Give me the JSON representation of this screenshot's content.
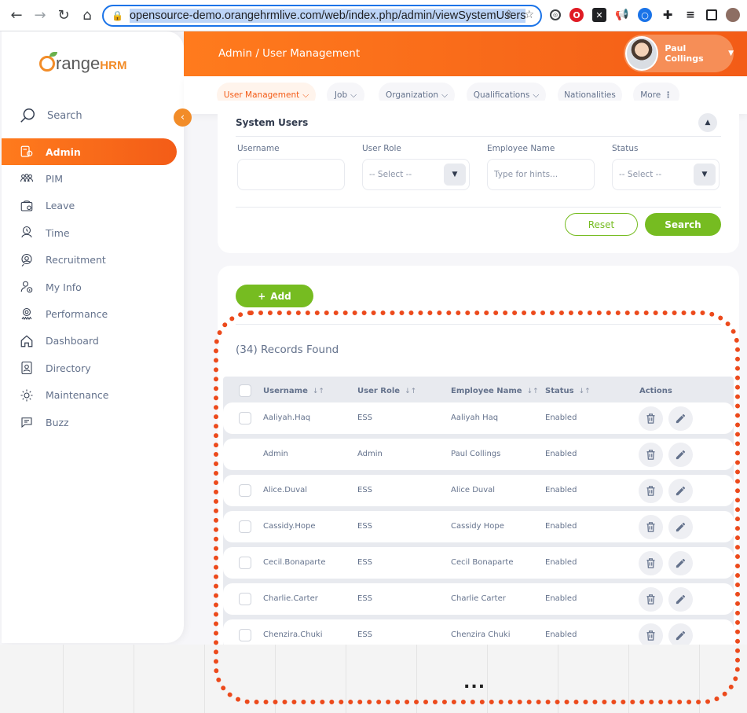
{
  "browser": {
    "url": "opensource-demo.orangehrmlive.com/web/index.php/admin/viewSystemUsers"
  },
  "logo": {
    "brand": "range",
    "suffix": "HRM"
  },
  "sidebar": {
    "search_label": "Search",
    "items": [
      {
        "label": "Admin",
        "icon": "admin-icon",
        "active": true
      },
      {
        "label": "PIM",
        "icon": "pim-icon"
      },
      {
        "label": "Leave",
        "icon": "leave-icon"
      },
      {
        "label": "Time",
        "icon": "time-icon"
      },
      {
        "label": "Recruitment",
        "icon": "recruitment-icon"
      },
      {
        "label": "My Info",
        "icon": "my-info-icon"
      },
      {
        "label": "Performance",
        "icon": "performance-icon"
      },
      {
        "label": "Dashboard",
        "icon": "dashboard-icon"
      },
      {
        "label": "Directory",
        "icon": "directory-icon"
      },
      {
        "label": "Maintenance",
        "icon": "maintenance-icon"
      },
      {
        "label": "Buzz",
        "icon": "buzz-icon"
      }
    ]
  },
  "header": {
    "breadcrumb": "Admin / User Management",
    "user_name": "Paul Collings"
  },
  "tabs": [
    {
      "label": "User Management",
      "caret": true,
      "active": true
    },
    {
      "label": "Job",
      "caret": true
    },
    {
      "label": "Organization",
      "caret": true
    },
    {
      "label": "Qualifications",
      "caret": true
    },
    {
      "label": "Nationalities",
      "caret": false
    },
    {
      "label": "More",
      "caret": false,
      "kebab": true
    }
  ],
  "filter": {
    "title": "System Users",
    "username_label": "Username",
    "username_value": "",
    "user_role_label": "User Role",
    "user_role_value": "-- Select --",
    "employee_name_label": "Employee Name",
    "employee_name_placeholder": "Type for hints...",
    "status_label": "Status",
    "status_value": "-- Select --",
    "reset_label": "Reset",
    "search_label": "Search"
  },
  "list": {
    "add_label": "Add",
    "records_found": "(34) Records Found",
    "columns": [
      "Username",
      "User Role",
      "Employee Name",
      "Status",
      "Actions"
    ],
    "rows": [
      {
        "username": "Aaliyah.Haq",
        "role": "ESS",
        "employee": "Aaliyah Haq",
        "status": "Enabled",
        "checkbox": true
      },
      {
        "username": "Admin",
        "role": "Admin",
        "employee": "Paul Collings",
        "status": "Enabled",
        "checkbox": false
      },
      {
        "username": "Alice.Duval",
        "role": "ESS",
        "employee": "Alice Duval",
        "status": "Enabled",
        "checkbox": true
      },
      {
        "username": "Cassidy.Hope",
        "role": "ESS",
        "employee": "Cassidy Hope",
        "status": "Enabled",
        "checkbox": true
      },
      {
        "username": "Cecil.Bonaparte",
        "role": "ESS",
        "employee": "Cecil Bonaparte",
        "status": "Enabled",
        "checkbox": true
      },
      {
        "username": "Charlie.Carter",
        "role": "ESS",
        "employee": "Charlie Carter",
        "status": "Enabled",
        "checkbox": true
      },
      {
        "username": "Chenzira.Chuki",
        "role": "ESS",
        "employee": "Chenzira Chuki",
        "status": "Enabled",
        "checkbox": true
      }
    ]
  },
  "colors": {
    "accent_orange": "#ff7b1d",
    "accent_green": "#76bc21",
    "annotation_red": "#ec4a1c"
  },
  "bottom": {
    "ellipsis": "..."
  }
}
